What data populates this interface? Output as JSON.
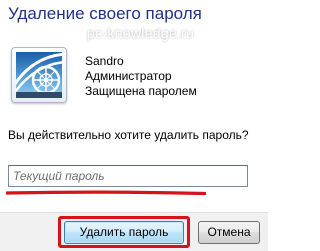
{
  "dialog": {
    "title": "Удаление своего пароля",
    "watermark": "pc-knowledge.ru"
  },
  "user": {
    "name": "Sandro",
    "role": "Администратор",
    "status": "Защищена паролем",
    "avatar_icon": "user-avatar-icon"
  },
  "question": "Вы действительно хотите удалить пароль?",
  "password_field": {
    "placeholder": "Текущий пароль",
    "value": ""
  },
  "buttons": {
    "remove_label": "Удалить пароль",
    "cancel_label": "Отмена"
  },
  "colors": {
    "title": "#1e3287",
    "annotation": "#d4131d",
    "button_primary_border": "#3c7fb1"
  }
}
